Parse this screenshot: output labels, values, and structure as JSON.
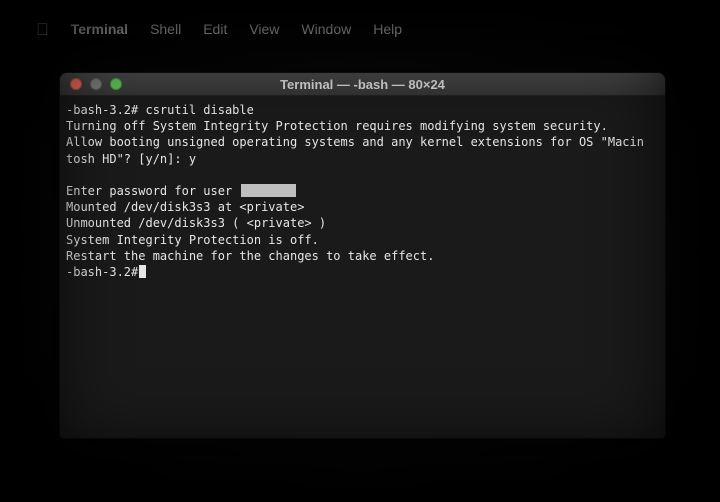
{
  "menubar": {
    "appName": "Terminal",
    "items": [
      "Shell",
      "Edit",
      "View",
      "Window",
      "Help"
    ]
  },
  "window": {
    "title": "Terminal — -bash — 80×24"
  },
  "terminal": {
    "prompt1": "-bash-3.2#",
    "command1": "csrutil disable",
    "line2": "Turning off System Integrity Protection requires modifying system security.",
    "line3a": "Allow booting unsigned operating systems and any kernel extensions for OS \"Macin",
    "line3b": "tosh HD\"? [y/n]:",
    "answer": "y",
    "line5": "Enter password for user",
    "line6": "Mounted /dev/disk3s3 at <private>",
    "line7": "Unmounted /dev/disk3s3 ( <private> )",
    "line8": "System Integrity Protection is off.",
    "line9": "Restart the machine for the changes to take effect.",
    "prompt2": "-bash-3.2#"
  }
}
